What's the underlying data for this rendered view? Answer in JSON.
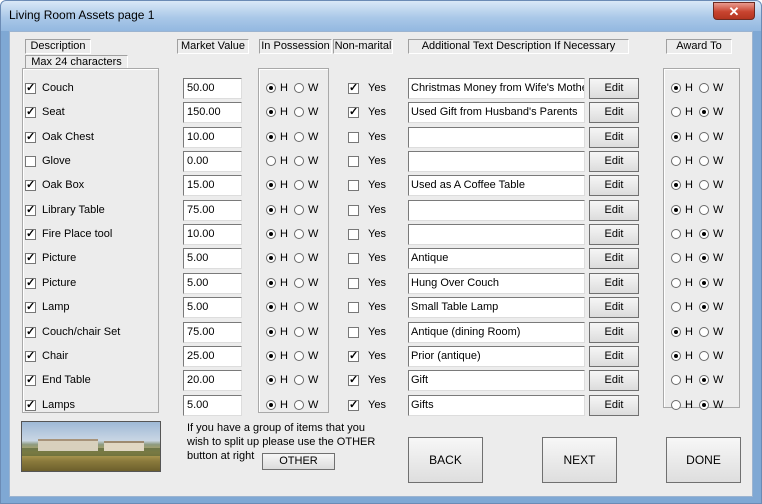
{
  "window": {
    "title": "Living Room Assets page 1",
    "close_glyph": "✕"
  },
  "headers": {
    "description": "Description",
    "max_chars": "Max 24 characters",
    "market_value": "Market Value",
    "in_possession": "In Possession",
    "non_marital": "Non-marital",
    "additional_text": "Additional Text  Description If Necessary",
    "award_to": "Award To"
  },
  "labels": {
    "h": "H",
    "w": "W",
    "yes": "Yes",
    "edit": "Edit"
  },
  "rows": [
    {
      "desc": "Couch",
      "checked": true,
      "value": "50.00",
      "possession": "H",
      "nonmarital": true,
      "text": "Christmas Money from Wife's Mother",
      "award": "H"
    },
    {
      "desc": "Seat",
      "checked": true,
      "value": "150.00",
      "possession": "H",
      "nonmarital": true,
      "text": "Used Gift from Husband's Parents",
      "award": "W"
    },
    {
      "desc": "Oak Chest",
      "checked": true,
      "value": "10.00",
      "possession": "H",
      "nonmarital": false,
      "text": "",
      "award": "H"
    },
    {
      "desc": "Glove",
      "checked": false,
      "value": "0.00",
      "possession": "",
      "nonmarital": false,
      "text": "",
      "award": ""
    },
    {
      "desc": "Oak Box",
      "checked": true,
      "value": "15.00",
      "possession": "H",
      "nonmarital": false,
      "text": "Used as A Coffee Table",
      "award": "H"
    },
    {
      "desc": "Library Table",
      "checked": true,
      "value": "75.00",
      "possession": "H",
      "nonmarital": false,
      "text": "",
      "award": "H"
    },
    {
      "desc": "Fire Place tool",
      "checked": true,
      "value": "10.00",
      "possession": "H",
      "nonmarital": false,
      "text": "",
      "award": "W"
    },
    {
      "desc": "Picture",
      "checked": true,
      "value": "5.00",
      "possession": "H",
      "nonmarital": false,
      "text": "Antique",
      "award": "W"
    },
    {
      "desc": "Picture",
      "checked": true,
      "value": "5.00",
      "possession": "H",
      "nonmarital": false,
      "text": "Hung Over Couch",
      "award": "W"
    },
    {
      "desc": "Lamp",
      "checked": true,
      "value": "5.00",
      "possession": "H",
      "nonmarital": false,
      "text": "Small Table Lamp",
      "award": "W"
    },
    {
      "desc": "Couch/chair Set",
      "checked": true,
      "value": "75.00",
      "possession": "H",
      "nonmarital": false,
      "text": "Antique (dining Room)",
      "award": "H"
    },
    {
      "desc": "Chair",
      "checked": true,
      "value": "25.00",
      "possession": "H",
      "nonmarital": true,
      "text": "Prior (antique)",
      "award": "H"
    },
    {
      "desc": "End Table",
      "checked": true,
      "value": "20.00",
      "possession": "H",
      "nonmarital": true,
      "text": "Gift",
      "award": "W"
    },
    {
      "desc": "Lamps",
      "checked": true,
      "value": "5.00",
      "possession": "H",
      "nonmarital": true,
      "text": "Gifts",
      "award": "W"
    }
  ],
  "note": {
    "line1": "If you have a group of items that you",
    "line2": "wish to split up please use the OTHER",
    "line3": "button at right"
  },
  "buttons": {
    "other": "OTHER",
    "back": "BACK",
    "next": "NEXT",
    "done": "DONE"
  }
}
